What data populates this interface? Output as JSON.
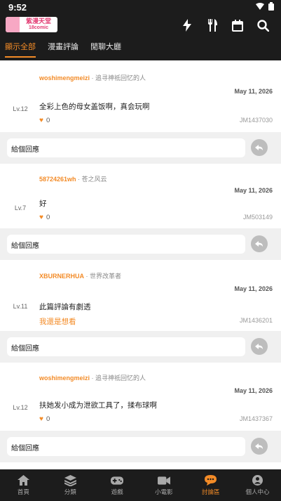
{
  "status": {
    "time": "9:52"
  },
  "app": {
    "logo_top": "紫漫天堂",
    "logo_bottom": "18comic"
  },
  "top_icons": [
    "lightning-icon",
    "utensils-icon",
    "calendar-icon",
    "search-icon"
  ],
  "tabs": [
    {
      "label": "顯示全部",
      "active": true
    },
    {
      "label": "漫畫評論",
      "active": false
    },
    {
      "label": "閒聊大廳",
      "active": false
    }
  ],
  "comments": [
    {
      "level": "Lv.12",
      "user": "woshimengmeizi",
      "subtitle": " · 追寻神祗回忆的人",
      "date": "May 11, 2026",
      "text": "全彩上色的母女盖饭啊，真会玩啊",
      "likes": "0",
      "jm": "JM1437030",
      "reply_placeholder": "給個回應"
    },
    {
      "level": "Lv.7",
      "user": "58724261wh",
      "subtitle": " · 苍之风云",
      "date": "May 11, 2026",
      "text": "好",
      "likes": "0",
      "jm": "JM503149",
      "reply_placeholder": "給個回應"
    },
    {
      "level": "Lv.11",
      "user": "XBURNERHUA",
      "subtitle": " · 世界改革者",
      "date": "May 11, 2026",
      "text": "此篇評論有劇透",
      "link": "我還是想看",
      "jm": "JM1436201",
      "reply_placeholder": "給個回應"
    },
    {
      "level": "Lv.12",
      "user": "woshimengmeizi",
      "subtitle": " · 追寻神祗回忆的人",
      "date": "May 11, 2026",
      "text": "扶她发小成为泄欲工具了，揉布球啊",
      "likes": "0",
      "jm": "JM1437367",
      "reply_placeholder": "給個回應"
    }
  ],
  "bottom_nav": [
    {
      "label": "首頁",
      "icon": "home-icon",
      "active": false
    },
    {
      "label": "分類",
      "icon": "layers-icon",
      "active": false
    },
    {
      "label": "遊戲",
      "icon": "gamepad-icon",
      "active": false
    },
    {
      "label": "小電影",
      "icon": "video-icon",
      "active": false
    },
    {
      "label": "討論區",
      "icon": "chat-icon",
      "active": true
    },
    {
      "label": "個人中心",
      "icon": "user-icon",
      "active": false
    }
  ],
  "colors": {
    "accent": "#f38b27",
    "bar": "#1c1c1c"
  }
}
